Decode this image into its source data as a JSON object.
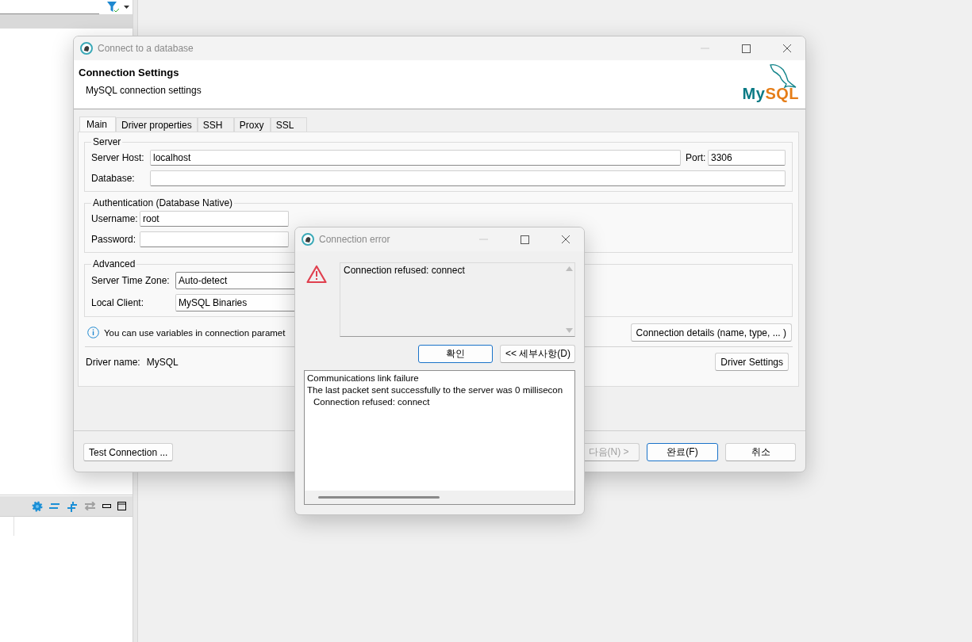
{
  "main_dialog": {
    "title": "Connect to a database",
    "header": {
      "title": "Connection Settings",
      "subtitle": "MySQL connection settings",
      "logo_part_1": "My",
      "logo_part_2": "SQL"
    },
    "tabs": [
      {
        "label": "Main",
        "selected": true
      },
      {
        "label": "Driver properties",
        "selected": false
      },
      {
        "label": "SSH",
        "selected": false
      },
      {
        "label": "Proxy",
        "selected": false
      },
      {
        "label": "SSL",
        "selected": false
      }
    ],
    "server": {
      "group_label": "Server",
      "host_label": "Server Host:",
      "host_value": "localhost",
      "port_label": "Port:",
      "port_value": "3306",
      "database_label": "Database:"
    },
    "authentication": {
      "group_label": "Authentication (Database Native)",
      "username_label": "Username:",
      "username_value": "root",
      "password_label": "Password:"
    },
    "advanced": {
      "group_label": "Advanced",
      "timezone_label": "Server Time Zone:",
      "timezone_value": "Auto-detect",
      "client_label": "Local Client:",
      "client_value": "MySQL Binaries"
    },
    "info_text": "You can use variables in connection paramet",
    "connection_details_button": "Connection details (name, type, ... )",
    "driver_name_label": "Driver name:",
    "driver_name_value": "MySQL",
    "driver_settings_button": "Driver Settings",
    "buttons": [
      {
        "label": "Test Connection ...",
        "disabled": false,
        "default": false
      },
      {
        "label": "다음(N) >",
        "disabled": true,
        "default": false
      },
      {
        "label": "완료(F)",
        "disabled": false,
        "default": true
      },
      {
        "label": "취소",
        "disabled": false,
        "default": false
      }
    ]
  },
  "error_dialog": {
    "title": "Connection error",
    "message": "Connection refused: connect",
    "buttons": [
      {
        "label": "확인",
        "default": true
      },
      {
        "label": "<< 세부사항(D)",
        "default": false
      }
    ],
    "details": [
      {
        "text": "Communications link failure",
        "indented": false
      },
      {
        "text": "The last packet sent successfully to the server was 0 millisecon",
        "indented": false
      },
      {
        "text": "Connection refused: connect",
        "indented": true
      }
    ]
  }
}
